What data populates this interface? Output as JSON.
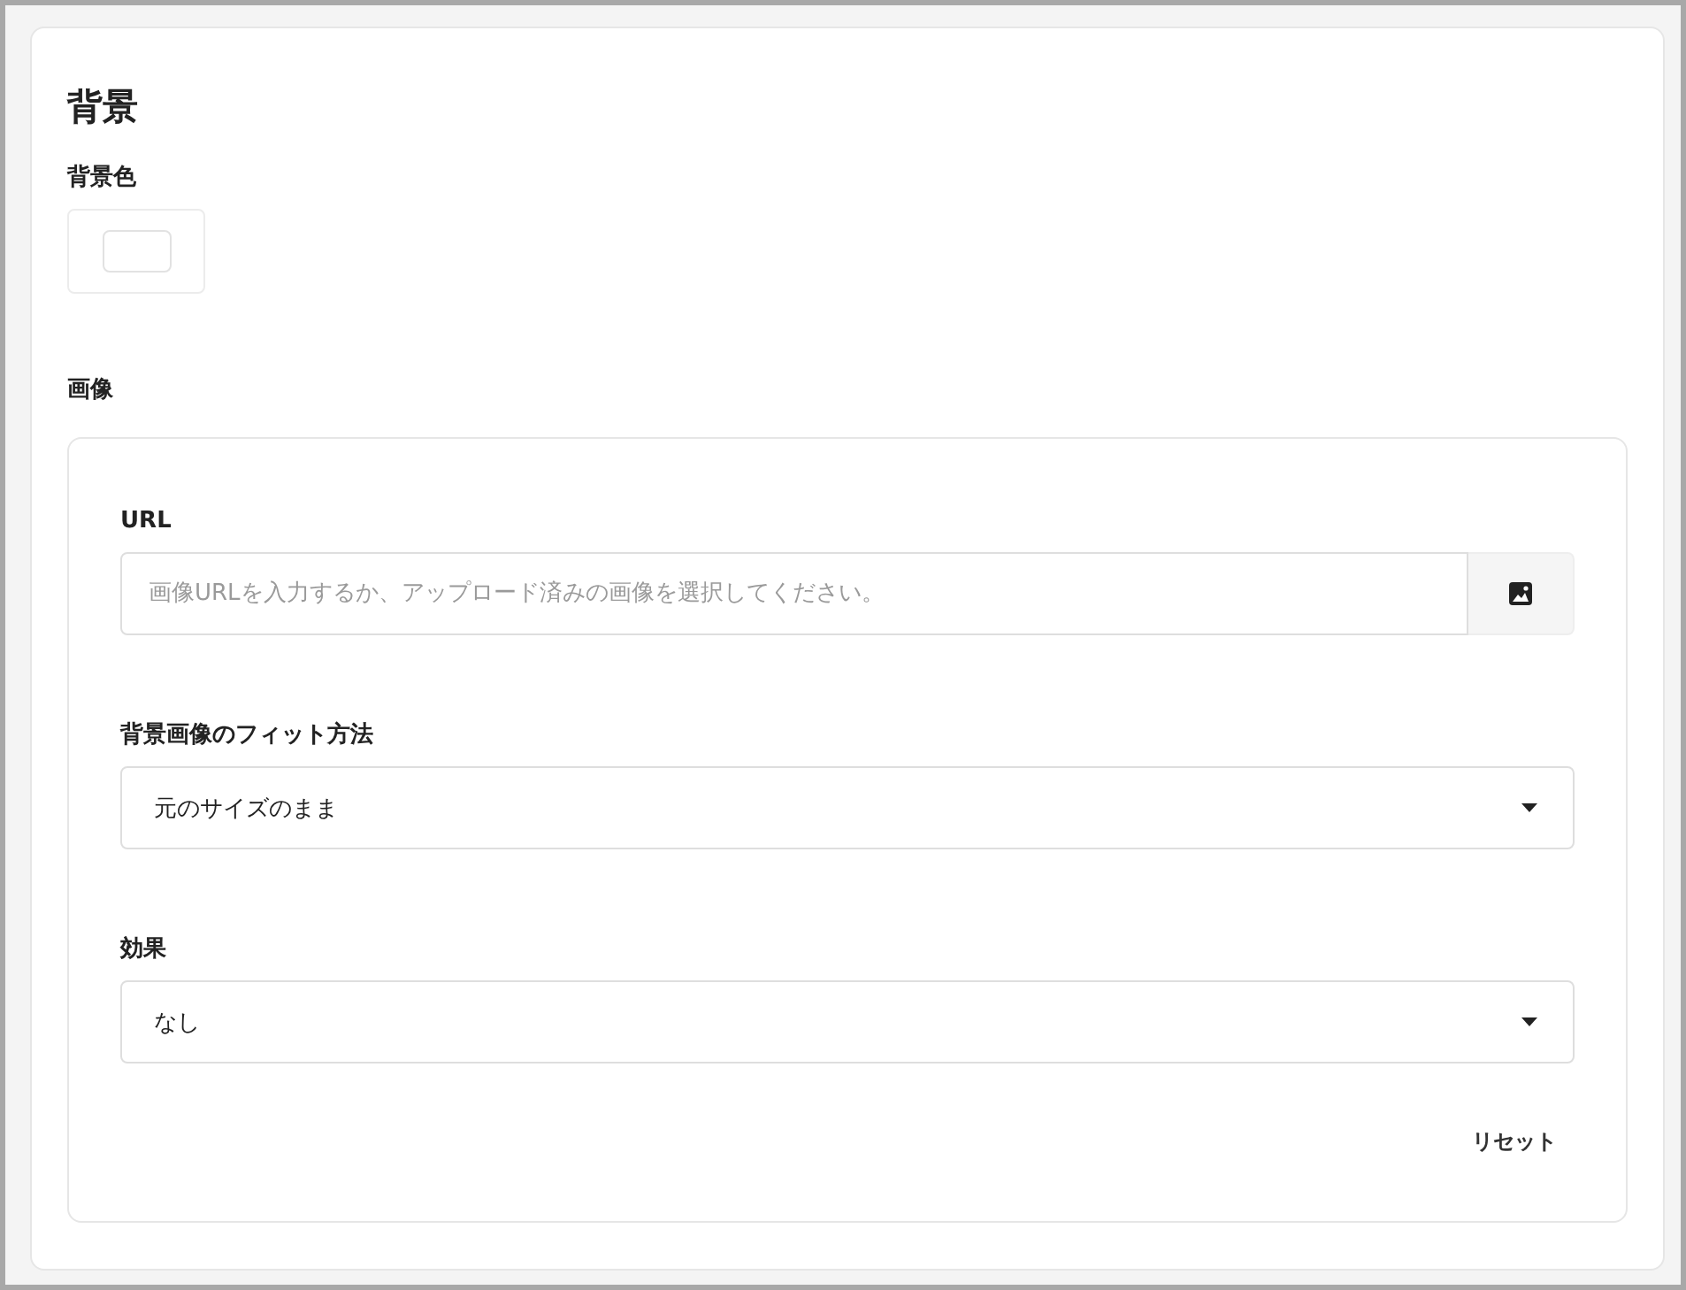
{
  "section": {
    "title": "背景"
  },
  "background_color": {
    "label": "背景色"
  },
  "image": {
    "heading": "画像",
    "url": {
      "label": "URL",
      "placeholder": "画像URLを入力するか、アップロード済みの画像を選択してください。"
    },
    "fit": {
      "label": "背景画像のフィット方法",
      "value": "元のサイズのまま"
    },
    "effect": {
      "label": "効果",
      "value": "なし"
    },
    "reset_button": "リセット"
  }
}
